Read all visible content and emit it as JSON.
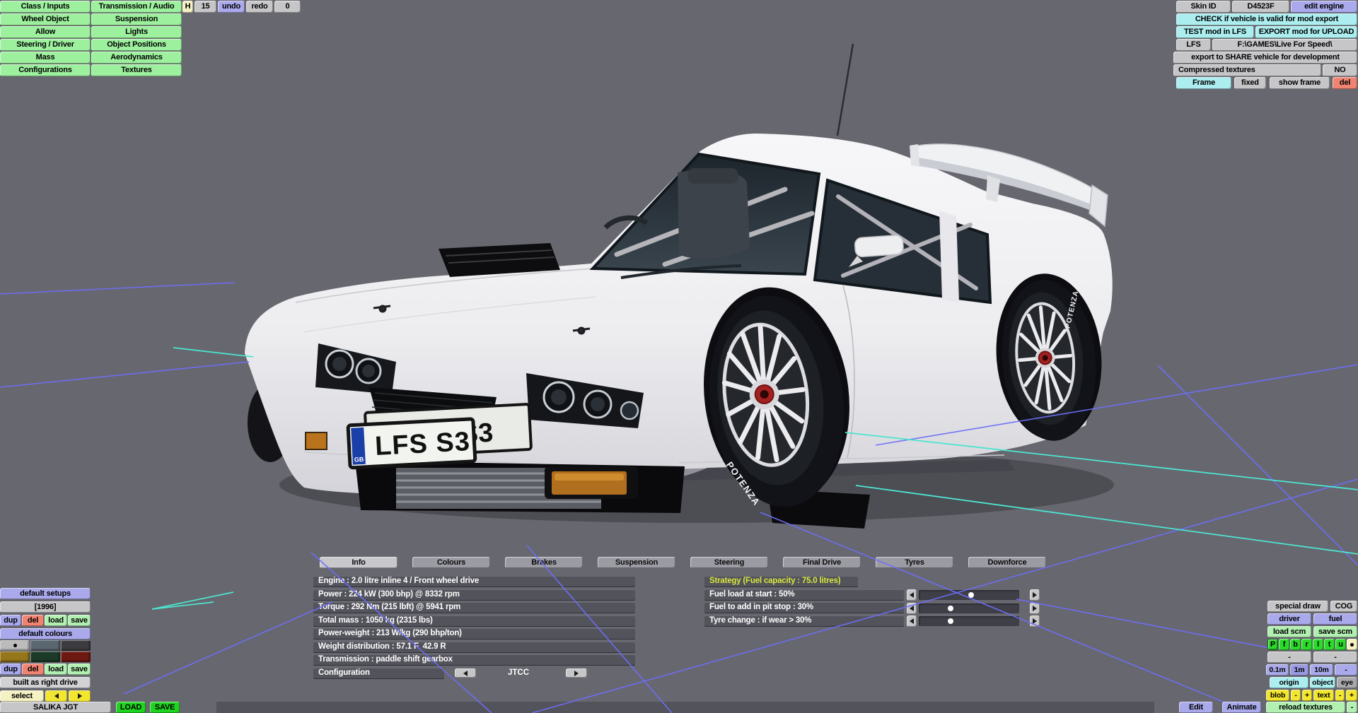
{
  "menu_left": {
    "col1": [
      "Class / Inputs",
      "Wheel Object",
      "Allow",
      "Steering / Driver",
      "Mass",
      "Configurations"
    ],
    "col2": [
      "Transmission / Audio",
      "Suspension",
      "Lights",
      "Object Positions",
      "Aerodynamics",
      "Textures"
    ]
  },
  "history_bar": {
    "h": "H",
    "count": "15",
    "undo": "undo",
    "redo": "redo",
    "zero": "0"
  },
  "export_panel": {
    "skin_id_label": "Skin ID",
    "skin_id_value": "D4523F",
    "edit_engine": "edit engine",
    "check": "CHECK if vehicle is valid for mod export",
    "test": "TEST mod in LFS",
    "export_upload": "EXPORT mod for UPLOAD",
    "lfs": "LFS",
    "lfs_path": "F:\\GAMES\\Live For Speed\\",
    "share": "export to SHARE vehicle for development",
    "compressed_label": "Compressed textures",
    "compressed_value": "NO",
    "frame": "Frame",
    "fixed": "fixed",
    "show_frame": "show frame",
    "del": "del"
  },
  "tabs": [
    {
      "label": "Info",
      "selected": true
    },
    {
      "label": "Colours",
      "selected": false
    },
    {
      "label": "Brakes",
      "selected": false
    },
    {
      "label": "Suspension",
      "selected": false
    },
    {
      "label": "Steering",
      "selected": false
    },
    {
      "label": "Final Drive",
      "selected": false
    },
    {
      "label": "Tyres",
      "selected": false
    },
    {
      "label": "Downforce",
      "selected": false
    }
  ],
  "info_panel": {
    "rows": [
      "Engine : 2.0 litre inline 4 / Front wheel drive",
      "Power : 224 kW (300 bhp) @ 8332 rpm",
      "Torque : 292 Nm (215 lbft) @ 5941 rpm",
      "Total mass : 1050 kg (2315 lbs)",
      "Power-weight : 213 W/kg (290 bhp/ton)",
      "Weight distribution : 57.1 F  42.9 R",
      "Transmission : paddle shift gearbox"
    ],
    "configuration": {
      "label": "Configuration",
      "value": "JTCC"
    }
  },
  "strategy_panel": {
    "header": "Strategy (Fuel capacity : 75.0 litres)",
    "rows": [
      {
        "label": "Fuel load at start : 50%",
        "percent": 52
      },
      {
        "label": "Fuel to add in pit stop : 30%",
        "percent": 32
      },
      {
        "label": "Tyre change : if wear > 30%",
        "percent": 32
      }
    ]
  },
  "setups_panel": {
    "default_setups": "default setups",
    "setup_name": "[1996]",
    "dup": "dup",
    "del": "del",
    "load": "load",
    "save": "save",
    "default_colours": "default colours",
    "swatches": [
      "#bcbcbc",
      "#5a6670",
      "#3c3c40",
      "#96761a",
      "#1c3a28",
      "#6e1812"
    ],
    "built_as": "built as right drive",
    "select": "select"
  },
  "vehicle_bar": {
    "name": "SALIKA JGT",
    "load": "LOAD",
    "save": "SAVE"
  },
  "view_panel": {
    "special_draw": "special draw",
    "cog": "COG",
    "driver": "driver",
    "fuel": "fuel",
    "load_scm": "load scm",
    "save_scm": "save scm",
    "letters": [
      "P",
      "f",
      "b",
      "r",
      "l",
      "t",
      "u"
    ],
    "dash1": "-",
    "dash2": "-",
    "scale_01": "0.1m",
    "scale_1": "1m",
    "scale_10": "10m",
    "scale_dash": "-",
    "origin": "origin",
    "object": "object",
    "eye": "eye",
    "blob": "blob",
    "blob_minus": "-",
    "blob_plus": "+",
    "text": "text",
    "text_minus": "-",
    "text_plus": "+",
    "edit": "Edit",
    "animate": "Animate",
    "reload_textures": "reload textures",
    "reload_minus": "-"
  },
  "viewport": {
    "license_plate": "LFS S3",
    "plate_country": "GB",
    "tyre_brand": "POTENZA",
    "colors": {
      "background": "#67676f",
      "grid": "#6e6ef8",
      "axis": "#4de4cf",
      "body": "#f2f2f4"
    }
  }
}
